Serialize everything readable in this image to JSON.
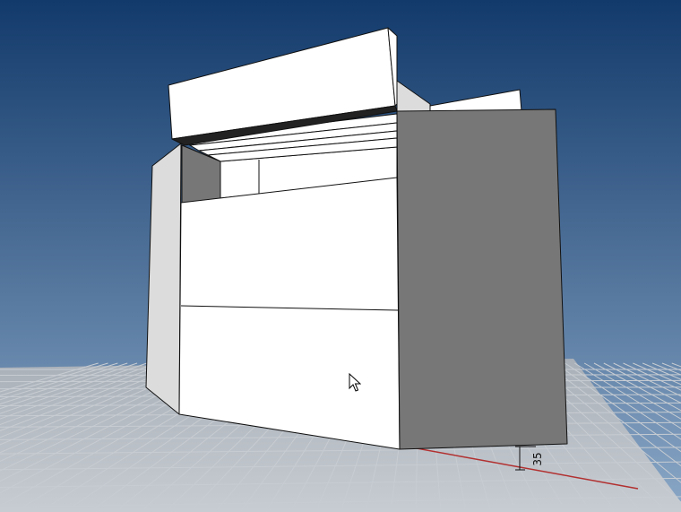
{
  "viewport": {
    "view": "perspective-3d",
    "dimension_label": "35",
    "colors": {
      "sky_top": "#123a6b",
      "sky_bottom": "#8aa7c6",
      "ground": "#a9b0b8",
      "grid_line": "#c7ccd2",
      "x_axis": "#b23030",
      "face_light": "#ffffff",
      "face_mid": "#dcdcdc",
      "face_dark": "#777777",
      "face_black": "#222222",
      "edge": "#111111"
    },
    "cursor": {
      "icon": "arrow-pointer-icon"
    }
  }
}
